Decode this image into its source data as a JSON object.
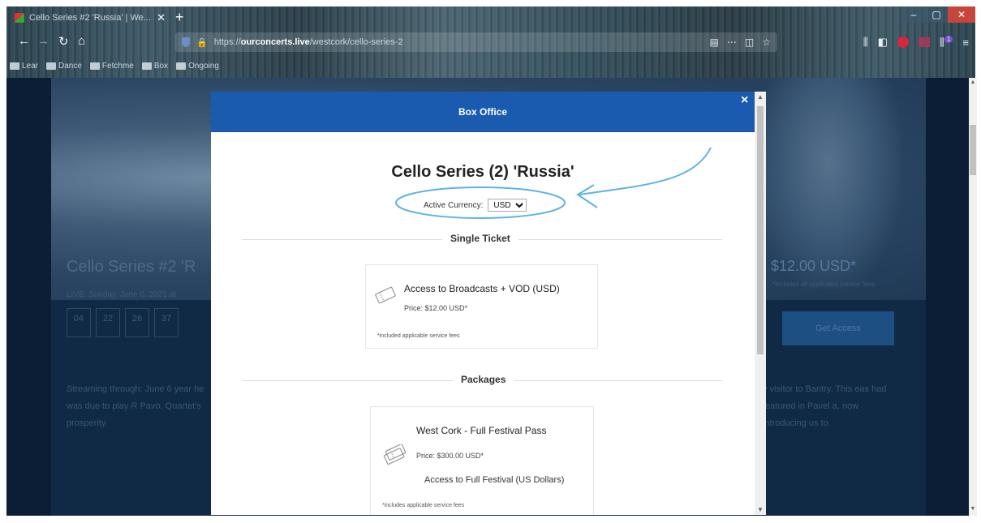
{
  "browser": {
    "tab_title": "Cello Series #2 'Russia' | We...",
    "url_prefix": "https://",
    "url_domain": "ourconcerts.live",
    "url_path": "/westcork/cello-series-2",
    "bookmarks": [
      "Lear",
      "Dance",
      "Fetchme",
      "Box",
      "Ongoing"
    ],
    "notification_count": "1"
  },
  "page": {
    "title": "Cello Series #2 'R",
    "date": "LIVE: Sunday, June 6, 2021 at",
    "countdown": [
      "04",
      "22",
      "26",
      "37"
    ],
    "para_left": "Streaming through: June 6 year he was due to play R Pavo, Quartet's prosperity",
    "price": "$12.00 USD*",
    "price_note": "*includes all applicable service fees",
    "buy_label": "Get Access",
    "para_right": "y visitor to Bantry. This eas had featured in Pavel a, now introducing us to"
  },
  "modal": {
    "header": "Box Office",
    "close": "×",
    "event_title": "Cello Series (2) 'Russia'",
    "currency_label": "Active Currency:",
    "currency_value": "USD",
    "currency_options": [
      "USD"
    ],
    "single_ticket_label": "Single Ticket",
    "packages_label": "Packages",
    "ticket": {
      "name": "Access to Broadcasts + VOD (USD)",
      "price": "Price: $12.00 USD*",
      "note": "*included applicable service fees"
    },
    "package": {
      "name": "West Cork - Full Festival Pass",
      "price": "Price: $300.00 USD*",
      "desc": "Access to Full Festival (US Dollars)",
      "note": "*includes applicable service fees"
    }
  },
  "colors": {
    "modal_header": "#1a5bb0",
    "annotation": "#5bb3e6"
  }
}
